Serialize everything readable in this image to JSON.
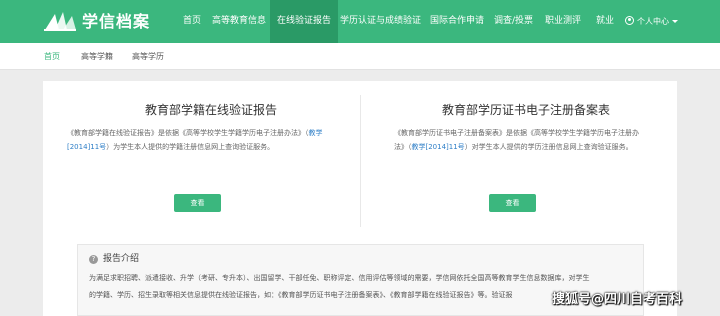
{
  "header": {
    "brand": "学信档案",
    "logo_icon": "book-stack-icon",
    "bg_color": "#3bb77e",
    "nav": [
      {
        "label": "首页",
        "active": false
      },
      {
        "label": "高等教育信息",
        "active": false
      },
      {
        "label": "在线验证报告",
        "active": true
      },
      {
        "label": "学历认证与成绩验证",
        "active": false
      },
      {
        "label": "国际合作申请",
        "active": false
      },
      {
        "label": "调查/投票",
        "active": false
      },
      {
        "label": "职业测评",
        "active": false
      },
      {
        "label": "就业",
        "active": false
      }
    ],
    "user_menu": {
      "label": "个人中心",
      "icon": "user-icon"
    }
  },
  "subnav": [
    {
      "label": "首页",
      "active": true
    },
    {
      "label": "高等学籍",
      "active": false
    },
    {
      "label": "高等学历",
      "active": false
    }
  ],
  "cards": [
    {
      "title": "教育部学籍在线验证报告",
      "desc_pre": "《教育部学籍在线验证报告》是依据《高等学校学生学籍学历电子注册办法》（",
      "desc_link": "教学[2014]11号",
      "desc_post": "）为学生本人提供的学籍注册信息网上查询验证服务。",
      "button": "查看"
    },
    {
      "title": "教育部学历证书电子注册备案表",
      "desc_pre": "《教育部学历证书电子注册备案表》是依据《高等学校学生学籍学历电子注册办法》（",
      "desc_link": "教学[2014]11号",
      "desc_post": "）对学生本人提供的学历注册信息网上查询验证服务。",
      "button": "查看"
    }
  ],
  "intro": {
    "heading": "报告介绍",
    "icon": "question-circle-icon",
    "line1": "为满足求职招聘、派遣接收、升学（考研、专升本）、出国留学、干部任免、职称评定、信用评估等领域的需要，学信网依托全国高等教育学生信息数据库，对学生",
    "line2": "的学籍、学历、招生录取等相关信息提供在线验证报告，如：《教育部学历证书电子注册备案表》、《教育部学籍在线验证报告》等。验证报"
  },
  "watermark": "搜狐号@四川自考百科"
}
